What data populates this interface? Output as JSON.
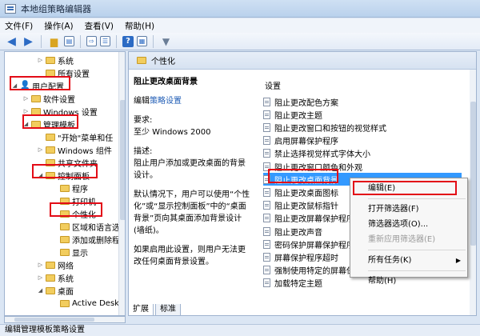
{
  "window": {
    "title": "本地组策略编辑器"
  },
  "menu": [
    "文件(F)",
    "操作(A)",
    "查看(V)",
    "帮助(H)"
  ],
  "icons": {
    "back": "back-arrow-icon",
    "forward": "forward-arrow-icon",
    "folder": "folder-icon",
    "help": "help-icon",
    "filter": "filter-icon"
  },
  "tree": [
    {
      "label": "系统",
      "twisty": "▷",
      "icon": "folder"
    },
    {
      "label": "所有设置",
      "twisty": "",
      "icon": "folder"
    },
    {
      "label": "用户配置",
      "twisty": "◢",
      "icon": "user"
    },
    {
      "label": "软件设置",
      "twisty": "▷",
      "icon": "folder"
    },
    {
      "label": "Windows 设置",
      "twisty": "▷",
      "icon": "folder"
    },
    {
      "label": "管理模板",
      "twisty": "◢",
      "icon": "folder"
    },
    {
      "label": "\"开始\"菜单和任",
      "twisty": "",
      "icon": "folder"
    },
    {
      "label": "Windows 组件",
      "twisty": "▷",
      "icon": "folder"
    },
    {
      "label": "共享文件夹",
      "twisty": "",
      "icon": "folder"
    },
    {
      "label": "控制面板",
      "twisty": "◢",
      "icon": "folder"
    },
    {
      "label": "程序",
      "twisty": "",
      "icon": "folder"
    },
    {
      "label": "打印机",
      "twisty": "",
      "icon": "folder"
    },
    {
      "label": "个性化",
      "twisty": "",
      "icon": "folder"
    },
    {
      "label": "区域和语言选",
      "twisty": "",
      "icon": "folder"
    },
    {
      "label": "添加或删除程",
      "twisty": "",
      "icon": "folder"
    },
    {
      "label": "显示",
      "twisty": "",
      "icon": "folder"
    },
    {
      "label": "网络",
      "twisty": "▷",
      "icon": "folder"
    },
    {
      "label": "系统",
      "twisty": "▷",
      "icon": "folder"
    },
    {
      "label": "桌面",
      "twisty": "◢",
      "icon": "folder"
    },
    {
      "label": "Active Deskt",
      "twisty": "",
      "icon": "folder"
    }
  ],
  "right_header": "个性化",
  "description": {
    "title": "阻止更改桌面背景",
    "edit_prefix": "编辑",
    "edit_link": "策略设置",
    "req_label": "要求:",
    "req_value": "至少 Windows 2000",
    "desc_label": "描述:",
    "desc_p1": "阻止用户添加或更改桌面的背景设计。",
    "desc_p2": "默认情况下，用户可以使用“个性化”或“显示控制面板”中的“桌面背景”页向其桌面添加背景设计(墙纸)。",
    "desc_p3": "如果启用此设置，则用户无法更改任何桌面背景设置。"
  },
  "settings_header": "设置",
  "settings": [
    "阻止更改配色方案",
    "阻止更改主题",
    "阻止更改窗口和按钮的视觉样式",
    "启用屏幕保护程序",
    "禁止选择视觉样式字体大小",
    "阻止更改窗口颜色和外观",
    "阻止更改桌面背景",
    "阻止更改桌面图标",
    "阻止更改鼠标指针",
    "阻止更改屏幕保护程序",
    "阻止更改声音",
    "密码保护屏幕保护程序",
    "屏幕保护程序超时",
    "强制使用特定的屏幕保",
    "加载特定主题"
  ],
  "context_menu": {
    "edit": "编辑(E)",
    "open_filter": "打开筛选器(F)",
    "filter_options": "筛选器选项(O)...",
    "reapply_filter": "重新应用筛选器(E)",
    "all_tasks": "所有任务(K)",
    "help": "帮助(H)"
  },
  "tabs": [
    "扩展",
    "标准"
  ],
  "status": "编辑管理模板策略设置"
}
